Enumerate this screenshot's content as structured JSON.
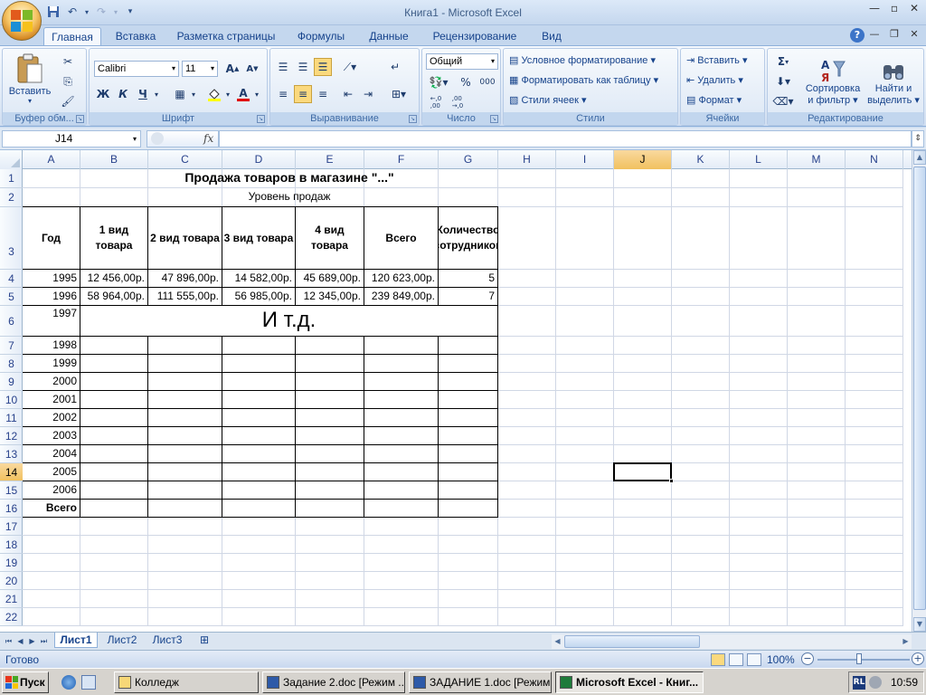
{
  "window": {
    "title": "Книга1 - Microsoft Excel"
  },
  "tabs": [
    "Главная",
    "Вставка",
    "Разметка страницы",
    "Формулы",
    "Данные",
    "Рецензирование",
    "Вид"
  ],
  "ribbon": {
    "clipboard": {
      "paste_label": "Вставить",
      "group_label": "Буфер обм..."
    },
    "font": {
      "name": "Calibri",
      "size": "11",
      "bold": "Ж",
      "italic": "К",
      "underline": "Ч",
      "group_label": "Шрифт"
    },
    "alignment": {
      "group_label": "Выравнивание"
    },
    "number": {
      "format": "Общий",
      "percent": "%",
      "thousands": "000",
      "dec_inc": ",0 ,00",
      "dec_dec": ",00 ,0",
      "group_label": "Число"
    },
    "styles": {
      "conditional": "Условное форматирование",
      "as_table": "Форматировать как таблицу",
      "cell_styles": "Стили ячеек",
      "group_label": "Стили"
    },
    "cells": {
      "insert": "Вставить",
      "delete": "Удалить",
      "format": "Формат",
      "group_label": "Ячейки"
    },
    "editing": {
      "sum": "Σ",
      "sort_line1": "Сортировка",
      "sort_line2": "и фильтр",
      "find_line1": "Найти и",
      "find_line2": "выделить",
      "group_label": "Редактирование"
    }
  },
  "formula_bar": {
    "name_box": "J14",
    "fx": "fx",
    "formula": ""
  },
  "columns": [
    "A",
    "B",
    "C",
    "D",
    "E",
    "F",
    "G",
    "H",
    "I",
    "J",
    "K",
    "L",
    "M",
    "N"
  ],
  "selected_column": "J",
  "rows": [
    "1",
    "2",
    "3",
    "4",
    "5",
    "6",
    "7",
    "8",
    "9",
    "10",
    "11",
    "12",
    "13",
    "14",
    "15",
    "16",
    "17",
    "18",
    "19",
    "20",
    "21",
    "22"
  ],
  "selected_row": "14",
  "sheet": {
    "title": "Продажа товаров в магазине \"...\"",
    "subtitle": "Уровень продаж",
    "headers": [
      "Год",
      "1 вид товара",
      "2 вид товара",
      "3 вид товара",
      "4 вид товара",
      "Всего",
      "Количество сотрудников"
    ],
    "data_rows": [
      [
        "1995",
        "12 456,00р.",
        "47 896,00р.",
        "14 582,00р.",
        "45 689,00р.",
        "120 623,00р.",
        "5"
      ],
      [
        "1996",
        "58 964,00р.",
        "111 555,00р.",
        "56 985,00р.",
        "12 345,00р.",
        "239 849,00р.",
        "7"
      ]
    ],
    "year_1997": "1997",
    "etc_note": "И т.д.",
    "years_rest": [
      "1998",
      "1999",
      "2000",
      "2001",
      "2002",
      "2003",
      "2004",
      "2005",
      "2006"
    ],
    "total_label": "Всего"
  },
  "sheet_tabs": [
    "Лист1",
    "Лист2",
    "Лист3"
  ],
  "status": {
    "ready": "Готово",
    "zoom": "100%"
  },
  "taskbar": {
    "start": "Пуск",
    "tasks": [
      "Колледж",
      "Задание 2.doc [Режим ...",
      "ЗАДАНИЕ 1.doc [Режим ...",
      "Microsoft Excel - Книг..."
    ],
    "lang": "RL",
    "clock": "10:59"
  }
}
